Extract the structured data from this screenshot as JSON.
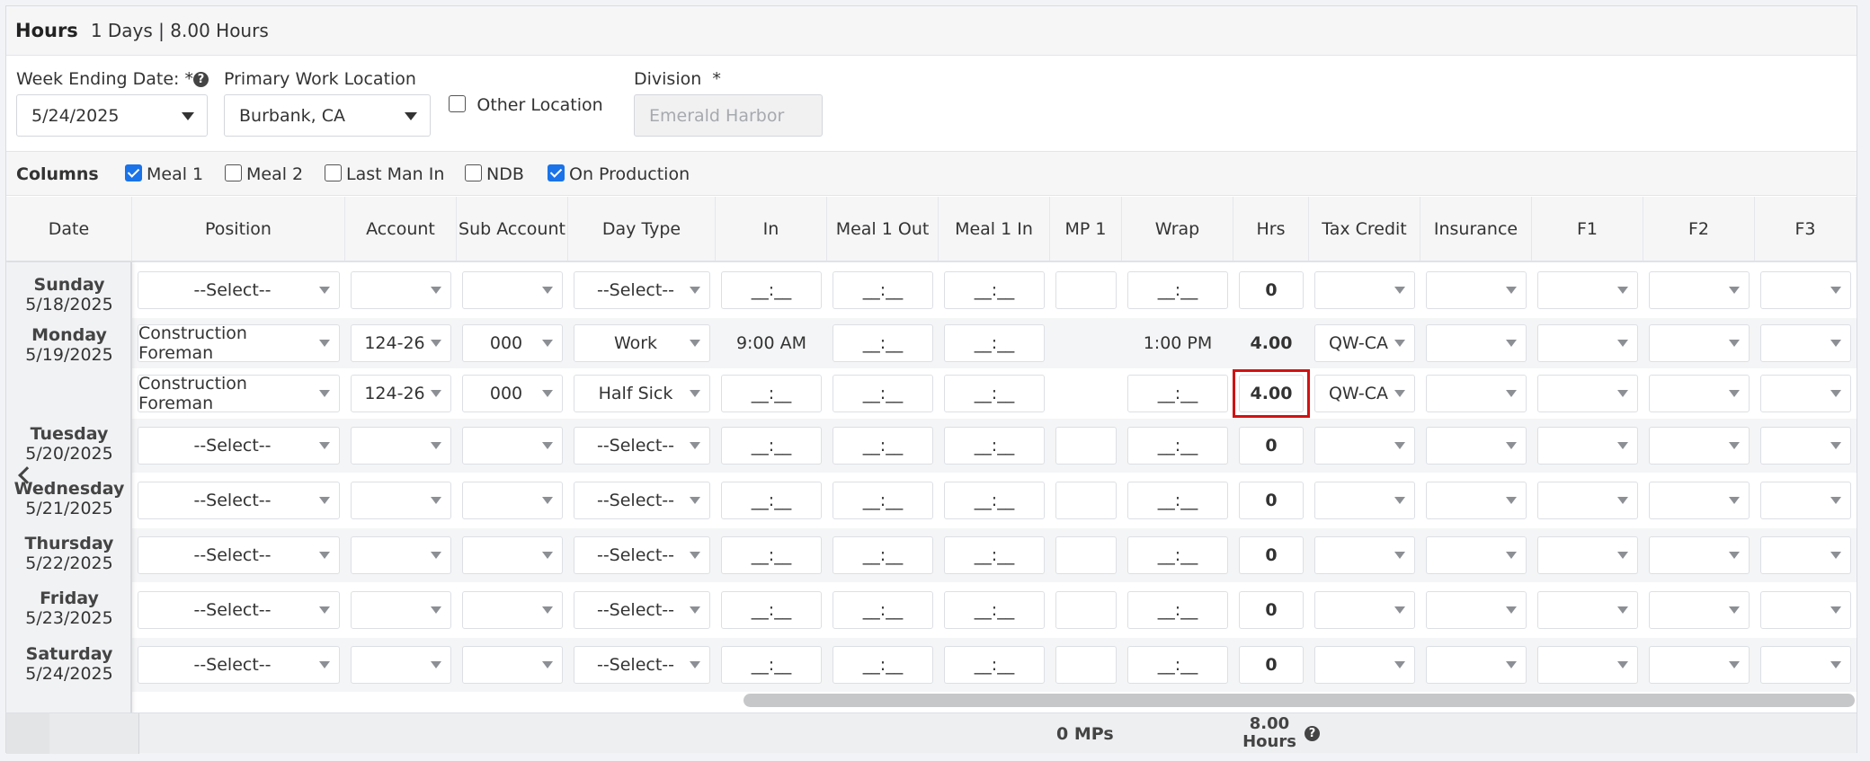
{
  "header": {
    "title": "Hours",
    "summary": "1 Days | 8.00 Hours"
  },
  "form": {
    "week_ending": {
      "label": "Week Ending Date:",
      "required": "*",
      "value": "5/24/2025"
    },
    "location": {
      "label": "Primary Work Location",
      "value": "Burbank, CA"
    },
    "other_location": {
      "label": "Other Location",
      "checked": false
    },
    "division": {
      "label": "Division",
      "required": "*",
      "placeholder": "Emerald Harbor"
    }
  },
  "columns": {
    "label": "Columns",
    "options": [
      {
        "label": "Meal 1",
        "checked": true
      },
      {
        "label": "Meal 2",
        "checked": false
      },
      {
        "label": "Last Man In",
        "checked": false
      },
      {
        "label": "NDB",
        "checked": false
      },
      {
        "label": "On Production",
        "checked": true
      }
    ]
  },
  "table": {
    "headers": [
      "Date",
      "Position",
      "Account",
      "Sub Account",
      "Day Type",
      "In",
      "Meal 1 Out",
      "Meal 1 In",
      "MP 1",
      "Wrap",
      "Hrs",
      "Tax Credit",
      "Insurance",
      "F1",
      "F2",
      "F3"
    ],
    "time_placeholder": "__:__",
    "rows": [
      {
        "day": "Sunday",
        "date": "5/18/2025",
        "position": "--Select--",
        "account": "",
        "sub_account": "",
        "day_type": "--Select--",
        "in": "",
        "meal_out": "",
        "meal_in": "",
        "wrap": "",
        "hrs": "0",
        "tax_credit": ""
      },
      {
        "day": "Monday",
        "date": "5/19/2025",
        "position": "Construction Foreman",
        "account": "124-26",
        "sub_account": "000",
        "day_type": "Work",
        "in": "9:00 AM",
        "meal_out": "",
        "meal_in": "",
        "wrap": "1:00 PM",
        "hrs": "4.00",
        "tax_credit": "QW-CA"
      },
      {
        "day": "",
        "date": "",
        "position": "Construction Foreman",
        "account": "124-26",
        "sub_account": "000",
        "day_type": "Half Sick",
        "in": "",
        "meal_out": "",
        "meal_in": "",
        "wrap": "",
        "hrs": "4.00",
        "tax_credit": "QW-CA"
      },
      {
        "day": "Tuesday",
        "date": "5/20/2025",
        "position": "--Select--",
        "account": "",
        "sub_account": "",
        "day_type": "--Select--",
        "in": "",
        "meal_out": "",
        "meal_in": "",
        "wrap": "",
        "hrs": "0",
        "tax_credit": ""
      },
      {
        "day": "Wednesday",
        "date": "5/21/2025",
        "position": "--Select--",
        "account": "",
        "sub_account": "",
        "day_type": "--Select--",
        "in": "",
        "meal_out": "",
        "meal_in": "",
        "wrap": "",
        "hrs": "0",
        "tax_credit": ""
      },
      {
        "day": "Thursday",
        "date": "5/22/2025",
        "position": "--Select--",
        "account": "",
        "sub_account": "",
        "day_type": "--Select--",
        "in": "",
        "meal_out": "",
        "meal_in": "",
        "wrap": "",
        "hrs": "0",
        "tax_credit": ""
      },
      {
        "day": "Friday",
        "date": "5/23/2025",
        "position": "--Select--",
        "account": "",
        "sub_account": "",
        "day_type": "--Select--",
        "in": "",
        "meal_out": "",
        "meal_in": "",
        "wrap": "",
        "hrs": "0",
        "tax_credit": ""
      },
      {
        "day": "Saturday",
        "date": "5/24/2025",
        "position": "--Select--",
        "account": "",
        "sub_account": "",
        "day_type": "--Select--",
        "in": "",
        "meal_out": "",
        "meal_in": "",
        "wrap": "",
        "hrs": "0",
        "tax_credit": ""
      }
    ]
  },
  "footer": {
    "mps": "0 MPs",
    "total_hours": "8.00",
    "total_label": "Hours"
  },
  "colors": {
    "highlight": "#d01212",
    "checkbox": "#1a73e8"
  }
}
